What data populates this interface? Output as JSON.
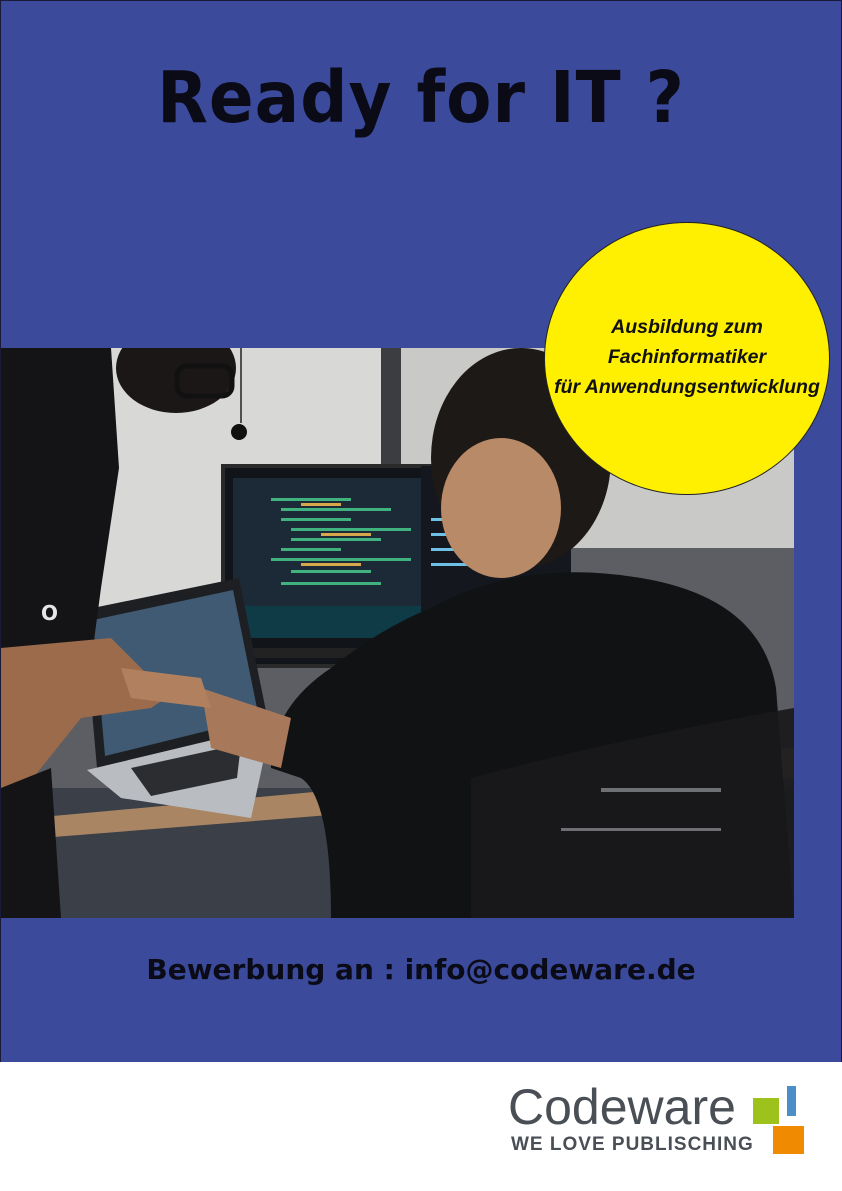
{
  "poster": {
    "headline": "Ready for IT ?",
    "badge": {
      "lines": [
        "Ausbildung zum",
        "Fachinformatiker",
        "für Anwendungsentwicklung"
      ]
    },
    "apply_text": "Bewerbung an : info@codeware.de"
  },
  "brand": {
    "name": "Codeware",
    "tagline": "WE LOVE PUBLISCHING"
  },
  "colors": {
    "poster_background": "#3b4a9b",
    "badge": "#ffef00",
    "text_dark": "#0b0b18",
    "logo_green": "#9dc21c",
    "logo_blue": "#4c8fc8",
    "logo_orange": "#f08a00"
  }
}
